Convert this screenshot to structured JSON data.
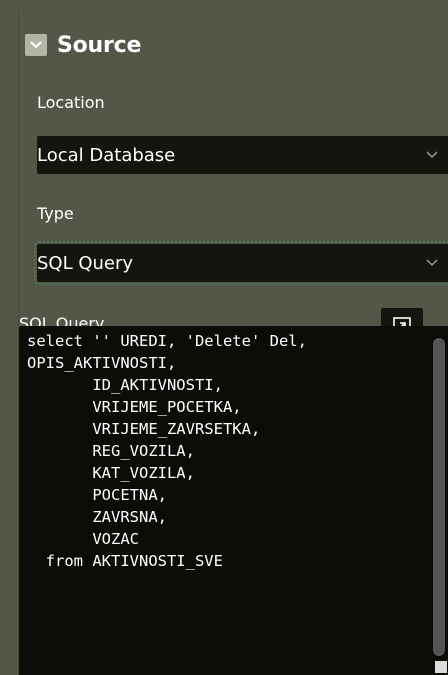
{
  "section": {
    "title": "Source"
  },
  "location": {
    "label": "Location",
    "value": "Local Database"
  },
  "type": {
    "label": "Type",
    "value": "SQL Query"
  },
  "sql": {
    "label": "SQL Query",
    "code": "select '' UREDI, 'Delete' Del,\nOPIS_AKTIVNOSTI,\n       ID_AKTIVNOSTI,\n       VRIJEME_POCETKA,\n       VRIJEME_ZAVRSETKA,\n       REG_VOZILA,\n       KAT_VOZILA,\n       POCETNA,\n       ZAVRSNA,\n       VOZAC\n  from AKTIVNOSTI_SVE"
  },
  "icons": {
    "collapse": "chevron-down-icon",
    "location_dropdown": "chevron-down-icon",
    "type_dropdown": "chevron-down-icon",
    "expand": "expand-icon",
    "resize": "resize-grip-icon"
  },
  "colors": {
    "background": "#565648",
    "field_background": "#15150f",
    "code_background": "#0b0b08",
    "text": "#ffffff",
    "focus_outline": "#4c7a55"
  }
}
